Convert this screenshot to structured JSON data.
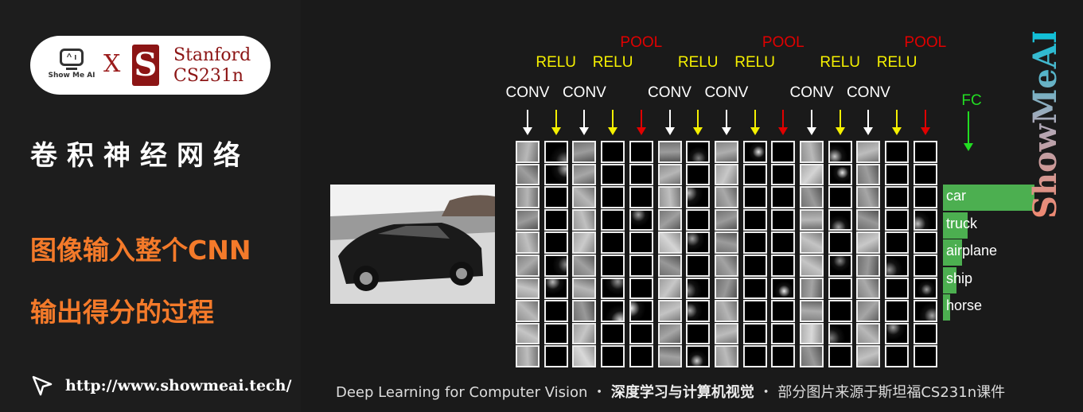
{
  "brand": {
    "showmeai_label": "Show Me AI",
    "times": "X",
    "stanford_logo": "S",
    "stanford_line1": "Stanford",
    "stanford_line2": "CS231n"
  },
  "title": "卷积神经网络",
  "subtitle_line1": "图像输入整个CNN",
  "subtitle_line2": "输出得分的过程",
  "url": "http://www.showmeai.tech/",
  "watermark": "ShowMeAI",
  "layers": [
    "CONV",
    "RELU",
    "CONV",
    "RELU",
    "POOL",
    "CONV",
    "RELU",
    "CONV",
    "RELU",
    "POOL",
    "CONV",
    "RELU",
    "CONV",
    "RELU",
    "POOL"
  ],
  "layer_colors": {
    "CONV": "#ffffff",
    "RELU": "#f5f000",
    "POOL": "#e00000",
    "FC": "#22dd22"
  },
  "fc_label": "FC",
  "scores": [
    {
      "label": "car",
      "value": 1.0
    },
    {
      "label": "truck",
      "value": 0.27
    },
    {
      "label": "airplane",
      "value": 0.21
    },
    {
      "label": "ship",
      "value": 0.15
    },
    {
      "label": "horse",
      "value": 0.08
    }
  ],
  "footer": {
    "en": "Deep Learning for Computer Vision",
    "sep": "・",
    "cn": "深度学习与计算机视觉",
    "note": "部分图片来源于斯坦福CS231n课件"
  }
}
